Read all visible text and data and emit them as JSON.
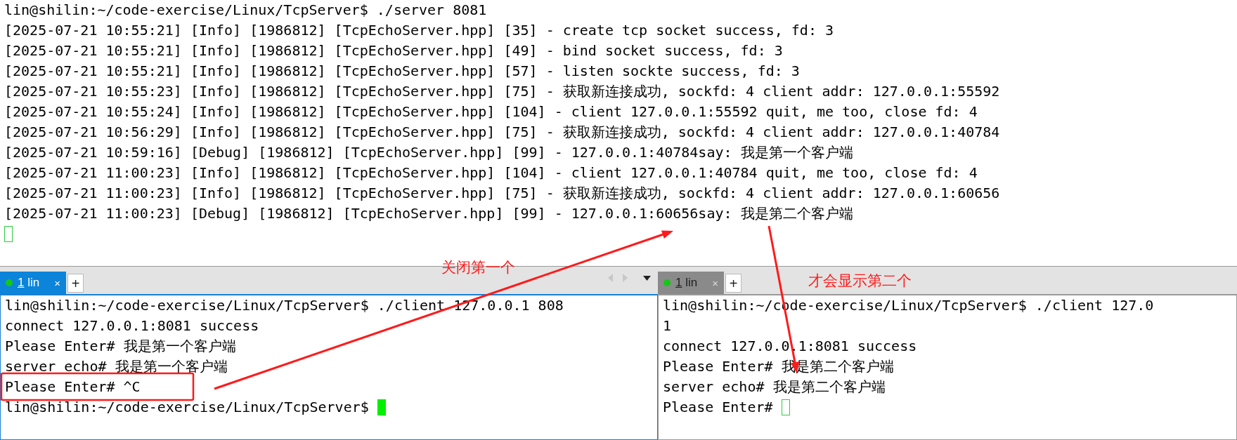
{
  "server_terminal": {
    "lines": [
      "lin@shilin:~/code-exercise/Linux/TcpServer$ ./server 8081",
      "[2025-07-21 10:55:21] [Info] [1986812] [TcpEchoServer.hpp] [35] - create tcp socket success, fd: 3",
      "[2025-07-21 10:55:21] [Info] [1986812] [TcpEchoServer.hpp] [49] - bind socket success, fd: 3",
      "[2025-07-21 10:55:21] [Info] [1986812] [TcpEchoServer.hpp] [57] - listen sockte success, fd: 3",
      "[2025-07-21 10:55:23] [Info] [1986812] [TcpEchoServer.hpp] [75] - 获取新连接成功, sockfd: 4 client addr: 127.0.0.1:55592",
      "[2025-07-21 10:55:24] [Info] [1986812] [TcpEchoServer.hpp] [104] - client 127.0.0.1:55592 quit, me too, close fd: 4",
      "[2025-07-21 10:56:29] [Info] [1986812] [TcpEchoServer.hpp] [75] - 获取新连接成功, sockfd: 4 client addr: 127.0.0.1:40784",
      "[2025-07-21 10:59:16] [Debug] [1986812] [TcpEchoServer.hpp] [99] - 127.0.0.1:40784say: 我是第一个客户端",
      "[2025-07-21 11:00:23] [Info] [1986812] [TcpEchoServer.hpp] [104] - client 127.0.0.1:40784 quit, me too, close fd: 4",
      "[2025-07-21 11:00:23] [Info] [1986812] [TcpEchoServer.hpp] [75] - 获取新连接成功, sockfd: 4 client addr: 127.0.0.1:60656",
      "[2025-07-21 11:00:23] [Debug] [1986812] [TcpEchoServer.hpp] [99] - 127.0.0.1:60656say: 我是第二个客户端"
    ],
    "focused": false
  },
  "panes": [
    {
      "tabs": [
        {
          "number": "1",
          "label": "lin",
          "close": "×",
          "selected": true
        }
      ],
      "add": "+",
      "scroll_arrows": true,
      "terminal": {
        "lines": [
          "lin@shilin:~/code-exercise/Linux/TcpServer$ ./client 127.0.0.1 808",
          "connect 127.0.0.1:8081 success",
          "Please Enter# 我是第一个客户端",
          "server echo# 我是第一个客户端",
          "Please Enter# ^C"
        ],
        "prompt": "lin@shilin:~/code-exercise/Linux/TcpServer$ ",
        "focused": true
      }
    },
    {
      "tabs": [
        {
          "number": "1",
          "label": "lin",
          "close": "×",
          "selected": false
        }
      ],
      "add": "+",
      "scroll_arrows": false,
      "terminal": {
        "lines": [
          "lin@shilin:~/code-exercise/Linux/TcpServer$ ./client 127.0",
          "1",
          "connect 127.0.0.1:8081 success",
          "Please Enter# 我是第二个客户端",
          "server echo# 我是第二个客户端"
        ],
        "prompt": "Please Enter# ",
        "focused": false
      }
    }
  ],
  "annotations": [
    {
      "kind": "note",
      "text": "关闭第一个"
    },
    {
      "kind": "note",
      "text": "才会显示第二个"
    },
    {
      "kind": "highlight"
    },
    {
      "kind": "arrow"
    },
    {
      "kind": "arrow"
    }
  ]
}
